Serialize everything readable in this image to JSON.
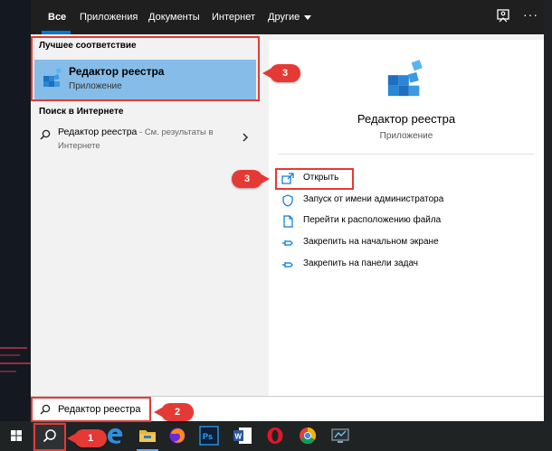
{
  "nav": {
    "tabs": [
      {
        "label": "Все",
        "active": true
      },
      {
        "label": "Приложения"
      },
      {
        "label": "Документы"
      },
      {
        "label": "Интернет"
      },
      {
        "label": "Другие"
      }
    ]
  },
  "left": {
    "best_match_header": "Лучшее соответствие",
    "best_match": {
      "name": "Редактор реестра",
      "kind": "Приложение"
    },
    "web_header": "Поиск в Интернете",
    "web_result": {
      "query": "Редактор реестра",
      "hint": " - См. результаты в Интернете"
    }
  },
  "right": {
    "app_name": "Редактор реестра",
    "app_kind": "Приложение",
    "actions": [
      {
        "label": "Открыть",
        "icon": "open-icon"
      },
      {
        "label": "Запуск от имени администратора",
        "icon": "run-as-admin-icon"
      },
      {
        "label": "Перейти к расположению файла",
        "icon": "file-location-icon"
      },
      {
        "label": "Закрепить на начальном экране",
        "icon": "pin-icon"
      },
      {
        "label": "Закрепить на панели задач",
        "icon": "pin-icon"
      }
    ]
  },
  "search": {
    "value": "Редактор реестра"
  },
  "taskbar": {
    "apps": [
      "edge",
      "file-explorer",
      "firefox",
      "photoshop",
      "word",
      "opera",
      "chrome",
      "monitor"
    ]
  },
  "annotations": {
    "step_search_button": "1",
    "step_search_box": "2",
    "step_best_match": "3",
    "step_open": "3"
  },
  "colors": {
    "accent": "#0078d7",
    "selection": "#85bde8",
    "annotation": "#e53935",
    "taskbar": "#1f2324"
  }
}
